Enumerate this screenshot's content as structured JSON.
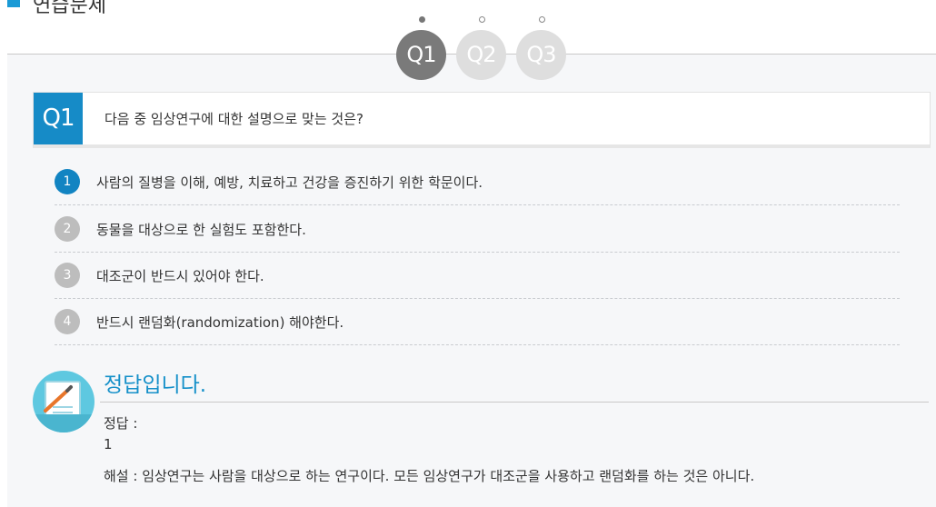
{
  "header": {
    "title": "연습문제"
  },
  "question_nav": [
    {
      "label": "Q1",
      "active": true
    },
    {
      "label": "Q2",
      "active": false
    },
    {
      "label": "Q3",
      "active": false
    }
  ],
  "question": {
    "badge": "Q1",
    "text": "다음 중 임상연구에 대한 설명으로 맞는 것은?"
  },
  "options": [
    {
      "num": "1",
      "label": "사람의 질병을 이해, 예방, 치료하고 건강을 증진하기 위한 학문이다.",
      "correct": true
    },
    {
      "num": "2",
      "label": "동물을 대상으로 한 실험도 포함한다.",
      "correct": false
    },
    {
      "num": "3",
      "label": "대조군이 반드시 있어야 한다.",
      "correct": false
    },
    {
      "num": "4",
      "label": "반드시 랜덤화(randomization) 해야한다.",
      "correct": false
    }
  ],
  "result": {
    "title": "정답입니다.",
    "answer_label": "정답 :",
    "answer_value": "1",
    "explanation": "해설 : 임상연구는 사람을 대상으로 하는 연구이다. 모든 임상연구가 대조군을 사용하고 랜덤화를 하는 것은 아니다."
  },
  "colors": {
    "accent": "#168bc7",
    "inactive": "#bdbdbd",
    "panel_bg": "#f6f7f9"
  }
}
